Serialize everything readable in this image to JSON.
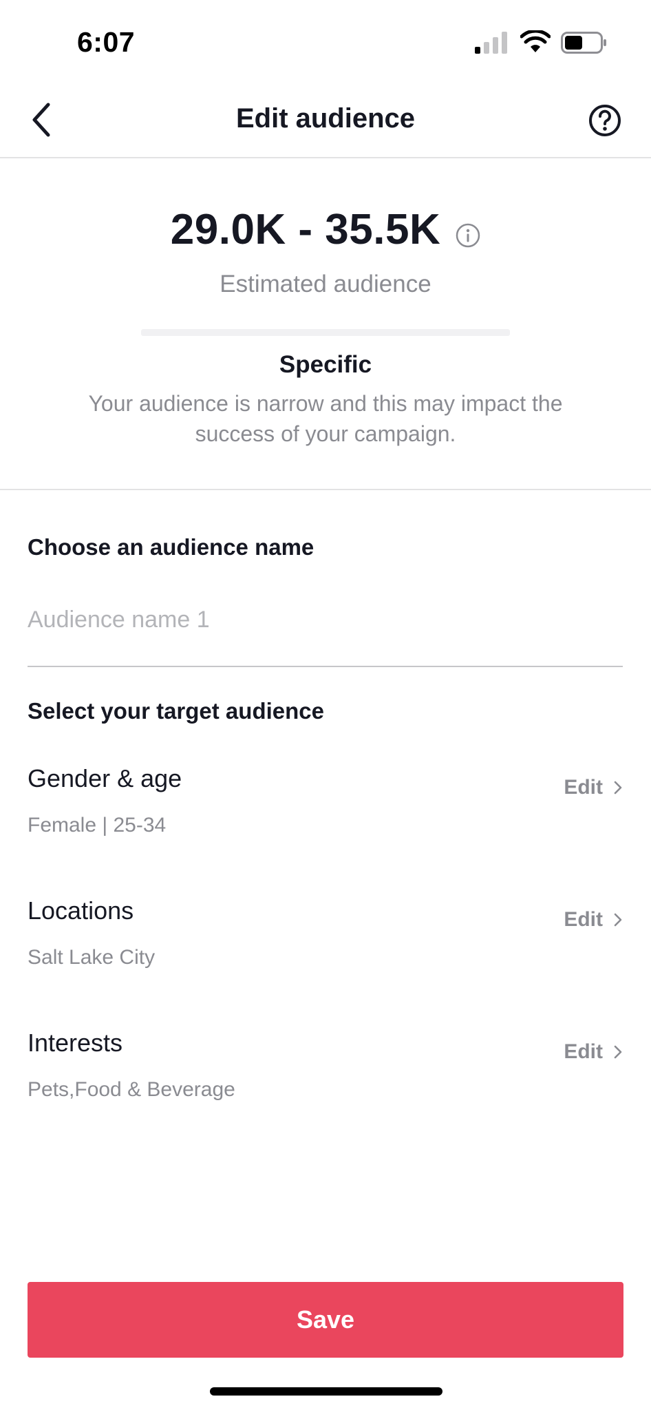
{
  "status_bar": {
    "time": "6:07"
  },
  "header": {
    "title": "Edit audience",
    "back_icon": "chevron-left-icon",
    "help_icon": "question-circle-icon"
  },
  "estimate": {
    "range": "29.0K - 35.5K",
    "caption": "Estimated audience",
    "info_icon": "info-circle-icon",
    "level_title": "Specific",
    "level_description": "Your audience is narrow and this may impact the success of your campaign."
  },
  "audience_name": {
    "heading": "Choose an audience name",
    "placeholder": "Audience name 1",
    "value": ""
  },
  "targeting": {
    "heading": "Select your target audience",
    "items": [
      {
        "title": "Gender & age",
        "value": "Female | 25-34",
        "edit_label": "Edit"
      },
      {
        "title": "Locations",
        "value": "Salt Lake City",
        "edit_label": "Edit"
      },
      {
        "title": "Interests",
        "value": "Pets,Food & Beverage",
        "edit_label": "Edit"
      }
    ]
  },
  "footer": {
    "save_label": "Save"
  },
  "colors": {
    "accent": "#ea465d",
    "text_primary": "#161823",
    "text_secondary": "#8a8b91",
    "divider": "#e3e3e4"
  }
}
